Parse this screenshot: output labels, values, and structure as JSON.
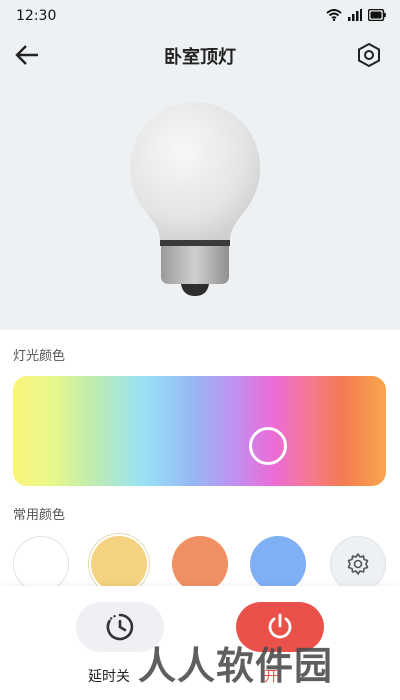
{
  "status": {
    "time": "12:30"
  },
  "header": {
    "title": "卧室顶灯"
  },
  "sections": {
    "color_label": "灯光颜色",
    "common_label": "常用颜色"
  },
  "swatches": [
    {
      "name": "white",
      "color": "#ffffff"
    },
    {
      "name": "warm-yellow",
      "color": "#f5d27f",
      "selected": true
    },
    {
      "name": "orange",
      "color": "#ef8f63"
    },
    {
      "name": "blue",
      "color": "#7fb0f4"
    }
  ],
  "actions": {
    "timer_label": "延时关",
    "power_label": "开"
  },
  "icons": {
    "back": "back-arrow-icon",
    "settings": "hexagon-settings-icon",
    "timer": "timer-icon",
    "power": "power-icon",
    "custom_color": "gear-icon"
  },
  "accent_color": "#e9514a",
  "watermark": "人人软件园"
}
